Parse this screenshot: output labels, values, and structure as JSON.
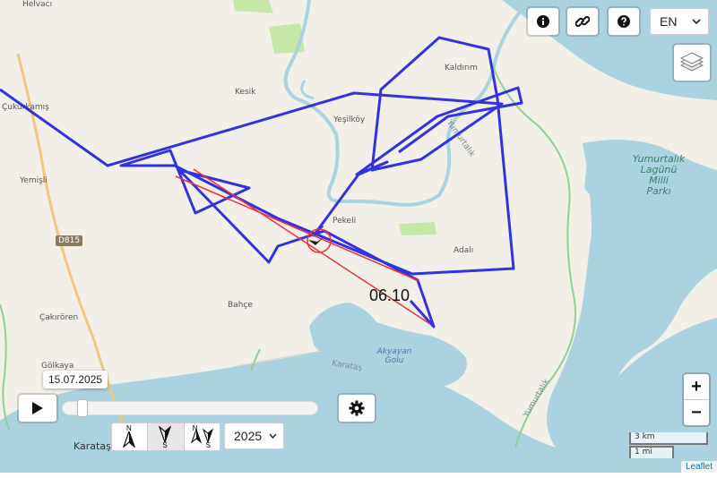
{
  "controls": {
    "info_icon": "info-icon",
    "link_icon": "link-icon",
    "help_icon": "help-icon",
    "language": "EN",
    "layers_icon": "layers-icon",
    "zoom_in": "+",
    "zoom_out": "−"
  },
  "map": {
    "places": [
      "Helvacı",
      "Kesik",
      "Çukurkamış",
      "Yeşilköy",
      "Kaldırım",
      "Yemişli",
      "Pekeli",
      "Adalı",
      "Bahçe",
      "Çakırören",
      "Gölkaya",
      "Karataş",
      "Karataş",
      "Yumurtalık",
      "Yumurtalık"
    ],
    "road_ref": "D815",
    "park_name": "Yumurtalık Lagünü Milli Parkı",
    "lake_name": "Akyayan Golu",
    "track_label": "06.10",
    "colors": {
      "track": "#3333dd",
      "highlight": "#e8343a"
    }
  },
  "timeline": {
    "date": "15.07.2025",
    "play_icon": "play-icon",
    "settings_icon": "gear-icon",
    "direction_options": [
      {
        "icon": "north-arrow-icon",
        "letters": [
          "N"
        ]
      },
      {
        "icon": "south-arrow-icon",
        "letters": [
          "S"
        ]
      },
      {
        "icon": "north-south-arrow-icon",
        "letters": [
          "N",
          "S"
        ]
      }
    ],
    "year": "2025",
    "progress": 0.03
  },
  "scale": {
    "km": "3 km",
    "mi": "1 mi"
  },
  "attribution": "Leaflet"
}
